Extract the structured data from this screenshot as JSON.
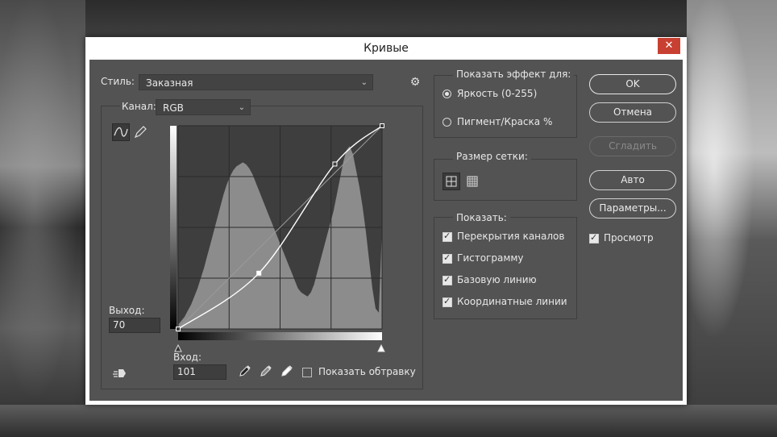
{
  "window": {
    "title": "Кривые",
    "close": "✕"
  },
  "style": {
    "label": "Стиль:",
    "value": "Заказная"
  },
  "channel": {
    "label": "Канал:",
    "value": "RGB"
  },
  "output": {
    "label": "Выход:",
    "value": "70"
  },
  "input": {
    "label": "Вход:",
    "value": "101"
  },
  "clipping": {
    "label": "Показать обтравку",
    "checked": false
  },
  "show_effect": {
    "title": "Показать эффект для:",
    "options": [
      {
        "label": "Яркость (0-255)",
        "selected": true
      },
      {
        "label": "Пигмент/Краска %",
        "selected": false
      }
    ]
  },
  "grid_size": {
    "title": "Размер сетки:"
  },
  "show": {
    "title": "Показать:",
    "items": [
      {
        "label": "Перекрытия каналов",
        "checked": true
      },
      {
        "label": "Гистограмму",
        "checked": true
      },
      {
        "label": "Базовую линию",
        "checked": true
      },
      {
        "label": "Координатные линии",
        "checked": true
      }
    ]
  },
  "buttons": {
    "ok": "OK",
    "cancel": "Отмена",
    "smooth": "Сгладить",
    "auto": "Авто",
    "params": "Параметры..."
  },
  "preview": {
    "label": "Просмотр",
    "checked": true
  },
  "curve": {
    "points": [
      [
        0,
        0
      ],
      [
        101,
        70
      ],
      [
        196,
        207
      ],
      [
        255,
        255
      ]
    ],
    "histogram": [
      2,
      4,
      6,
      9,
      12,
      16,
      20,
      25,
      30,
      36,
      42,
      48,
      54,
      60,
      66,
      71,
      75,
      78,
      80,
      81,
      82,
      81,
      79,
      76,
      72,
      68,
      64,
      60,
      56,
      52,
      48,
      44,
      40,
      36,
      32,
      28,
      24,
      20,
      18,
      17,
      16,
      18,
      22,
      28,
      34,
      40,
      46,
      52,
      58,
      66,
      74,
      82,
      88,
      90,
      86,
      78,
      70,
      60,
      48,
      34,
      20,
      10,
      8,
      50
    ]
  },
  "colors": {
    "panel": "#535353",
    "titlebar": "#ffffff",
    "close": "#c84031"
  }
}
